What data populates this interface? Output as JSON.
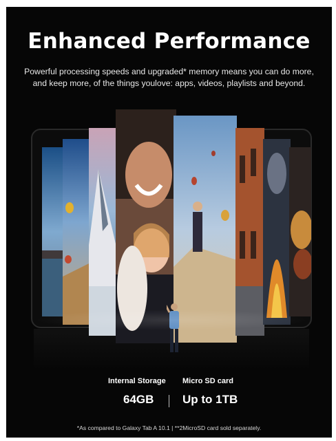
{
  "promo": {
    "title": "Enhanced Performance",
    "subtitle": "Powerful processing speeds and upgraded* memory means you can do more, and keep more, of the things youlove: apps, videos, playlists and beyond.",
    "specs": [
      {
        "label": "Internal Storage",
        "value": "64GB"
      },
      {
        "label": "Micro SD card",
        "value": "Up to 1TB"
      }
    ],
    "footnote": "*As compared to Galaxy Tab A 10.1 | **2MicroSD card sold separately."
  },
  "colors": {
    "background": "#060606",
    "text": "#ffffff"
  },
  "images": [
    {
      "name": "lake-at-sunset-photo"
    },
    {
      "name": "hot-air-balloon-canyon-photo"
    },
    {
      "name": "snowy-mountain-photo"
    },
    {
      "name": "smiling-children-photo"
    },
    {
      "name": "hiker-with-balloons-photo"
    },
    {
      "name": "brick-building-photo"
    },
    {
      "name": "campfire-photo"
    },
    {
      "name": "food-bowl-photo"
    }
  ]
}
